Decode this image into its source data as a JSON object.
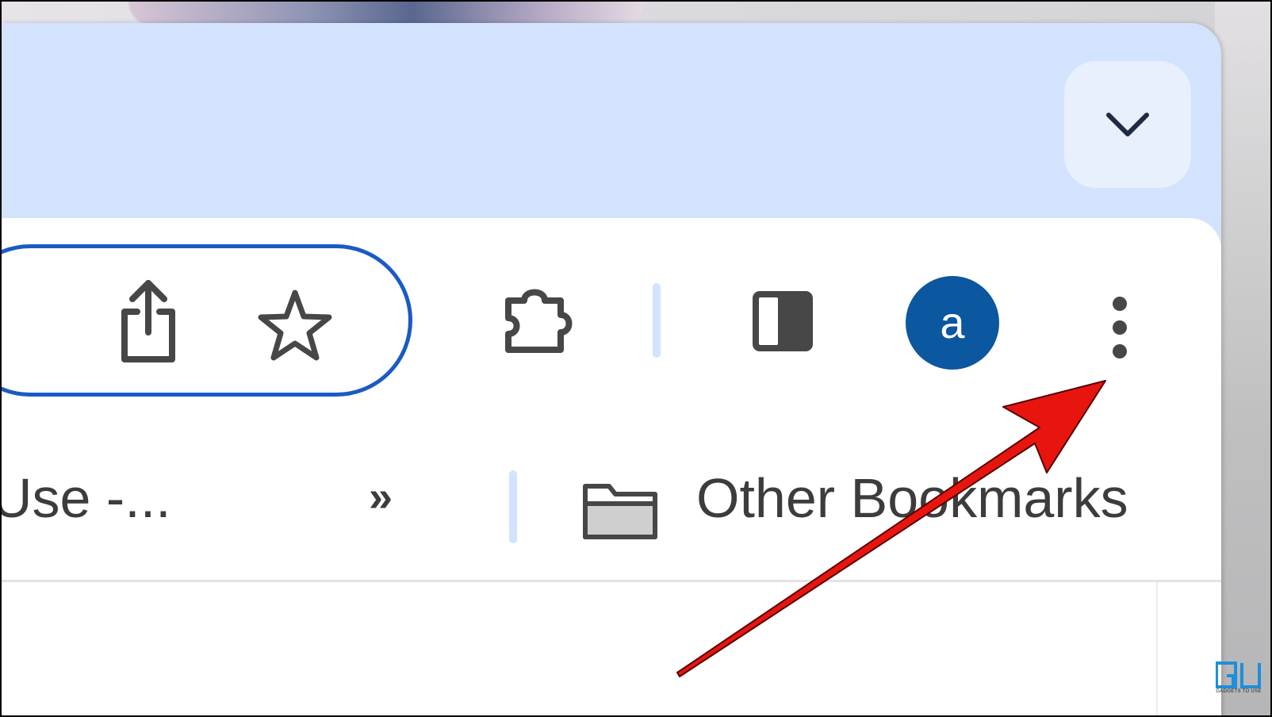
{
  "toolbar": {
    "avatar_letter": "a"
  },
  "bookmarks_bar": {
    "truncated_bookmark": "Use -...",
    "overflow_chevron": "»",
    "other_bookmarks": "Other Bookmarks"
  },
  "watermark": {
    "logo_text": "GU",
    "tagline": "GADGETS TO USE"
  },
  "icons": {
    "tab_search": "chevron-down-icon",
    "share": "share-icon",
    "bookmark_star": "star-icon",
    "extensions": "puzzle-icon",
    "side_panel": "side-panel-icon",
    "menu": "vertical-dots-icon",
    "folder": "folder-icon"
  },
  "colors": {
    "tabstrip": "#d3e3fd",
    "omnibox_border": "#1a5ac5",
    "avatar": "#0b57a0",
    "annotation_arrow": "#e8150f",
    "icon": "#474747"
  }
}
